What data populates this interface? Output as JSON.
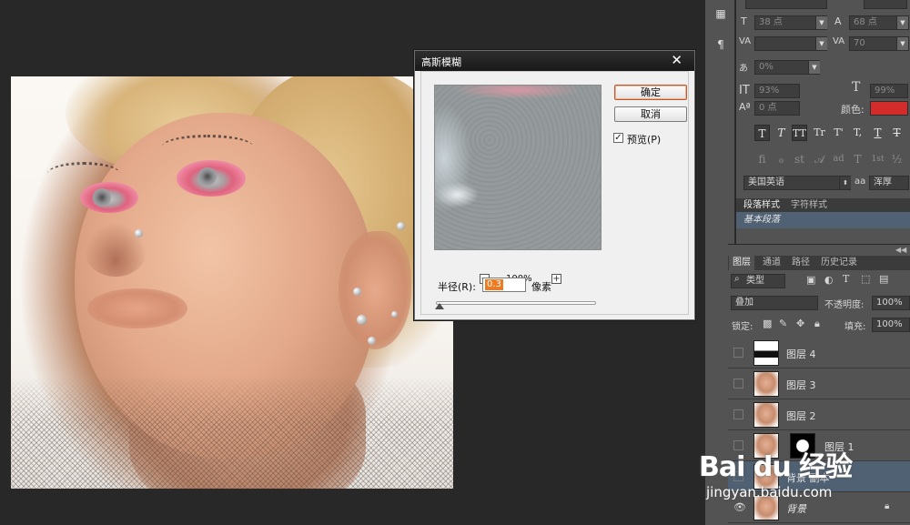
{
  "dialog": {
    "title": "高斯模糊",
    "close_glyph": "✕",
    "ok_label": "确定",
    "cancel_label": "取消",
    "preview_label": "预览(P)",
    "preview_checked": true,
    "zoom": "100%",
    "zoom_out_glyph": "−",
    "zoom_in_glyph": "+",
    "radius_label": "半径(R):",
    "radius_value": "0.3",
    "radius_unit": "像素"
  },
  "character_panel": {
    "font_size": "38 点",
    "leading": "68 点",
    "kerning": "",
    "tracking": "70",
    "baseline_shift_pct": "0%",
    "vertical_scale": "93%",
    "horizontal_scale": "99%",
    "baseline": "0 点",
    "color_label": "颜色:",
    "color": "#d42b2b",
    "language": "美国英语",
    "aa_label": "aa",
    "aa_method": "浑厚",
    "style_buttons": [
      "T",
      "T",
      "TT",
      "Tr",
      "T'",
      "T,",
      "T",
      "T"
    ],
    "opentype_buttons": [
      "fi",
      "ℴ",
      "st",
      "𝒜",
      "ad",
      "T",
      "1st",
      "½"
    ]
  },
  "style_tabs": [
    "段落样式",
    "字符样式"
  ],
  "paragraph_style_selected": "基本段落",
  "layers_panel": {
    "tabs": [
      "图层",
      "通道",
      "路径",
      "历史记录"
    ],
    "filter_kind": "类型",
    "blend_mode": "叠加",
    "opacity_label": "不透明度:",
    "opacity": "100%",
    "lock_label": "锁定:",
    "fill_label": "填充:",
    "fill": "100%",
    "layers": [
      {
        "name": "图层 4"
      },
      {
        "name": "图层 3"
      },
      {
        "name": "图层 2"
      },
      {
        "name": "图层 1"
      },
      {
        "name": "背景 副本"
      },
      {
        "name": "背景"
      }
    ]
  },
  "watermark": {
    "brand": "Bai du 经验",
    "url": "jingyan.baidu.com"
  }
}
